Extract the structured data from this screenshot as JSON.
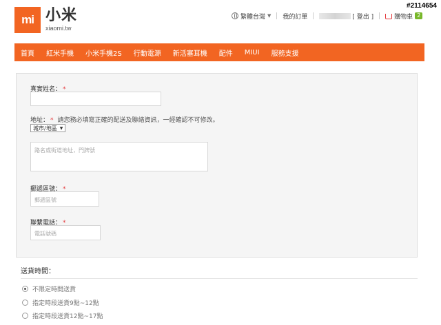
{
  "watermark": "#2114654",
  "brand": {
    "logo_mark": "mi",
    "name": "小米",
    "domain": "xiaomi.tw",
    "color": "#f26522"
  },
  "topbar": {
    "region": "繁體台灣",
    "orders": "我的訂單",
    "logout": "[ 登出 ]",
    "cart_label": "購物車",
    "cart_count": "2"
  },
  "nav": {
    "items": [
      {
        "label": "首頁"
      },
      {
        "label": "紅米手機"
      },
      {
        "label": "小米手機2S"
      },
      {
        "label": "行動電源"
      },
      {
        "label": "新活塞耳機"
      },
      {
        "label": "配件"
      },
      {
        "label": "MIUI"
      },
      {
        "label": "服務支援"
      }
    ]
  },
  "form": {
    "name_label": "真實姓名：",
    "name_required": "*",
    "address_label": "地址：",
    "address_required": "*",
    "address_hint": "請您務必填寫正確的配送及聯絡資訊，一經確認不可修改。",
    "city_select": "城市/地區",
    "street_placeholder": "路名或街道地址，門牌號",
    "zip_label": "郵遞區號：",
    "zip_required": "*",
    "zip_placeholder": "郵遞區號",
    "phone_label": "聯繫電話：",
    "phone_required": "*",
    "phone_placeholder": "電話號碼"
  },
  "shipping": {
    "title": "送貨時間：",
    "options": [
      {
        "label": "不限定時間送貨",
        "selected": true
      },
      {
        "label": "指定時段送貨9點~12點",
        "selected": false
      },
      {
        "label": "指定時段送貨12點~17點",
        "selected": false
      }
    ]
  }
}
